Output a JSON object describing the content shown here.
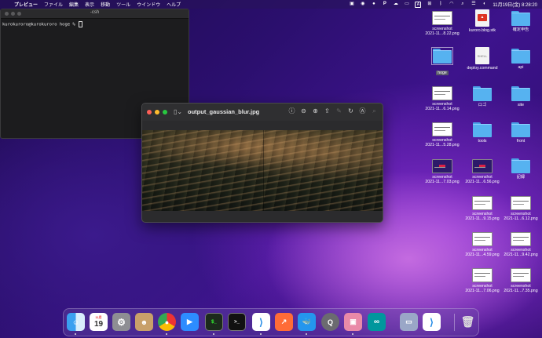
{
  "menubar": {
    "app_name": "プレビュー",
    "menus": [
      "ファイル",
      "編集",
      "表示",
      "移動",
      "ツール",
      "ウインドウ",
      "ヘルプ"
    ],
    "status_icons": [
      "display-icon",
      "accessibility-icon",
      "record-icon",
      "parking-icon",
      "cloud-icon",
      "cast-icon",
      "text-input-icon",
      "grid-icon",
      "bluetooth-icon",
      "wifi-icon",
      "search-icon",
      "control-center-icon",
      "siri-icon"
    ],
    "input_label": "A",
    "clock": "11月19日(金) 8:28:20"
  },
  "terminal": {
    "title": "-csh",
    "prompt": "kurokuroro@kurokuroro hoge % "
  },
  "preview": {
    "title": "output_gaussian_blur.jpg",
    "traffic_colors": [
      "#ff5f57",
      "#febc2e",
      "#28c840"
    ]
  },
  "desktop": {
    "icons": [
      {
        "kind": "shot",
        "label1": "screenshot",
        "label2": "2021-11...8.22.png"
      },
      {
        "kind": "doc",
        "label1": "kuroro.blog.stk",
        "label2": ""
      },
      {
        "kind": "folder",
        "label1": "確定申告",
        "label2": ""
      },
      {
        "kind": "folder",
        "label1": "hoge",
        "label2": "",
        "selected": true
      },
      {
        "kind": "shell",
        "label1": "deploy.command",
        "label2": ""
      },
      {
        "kind": "folder",
        "label1": "api",
        "label2": ""
      },
      {
        "kind": "shot",
        "label1": "screenshot",
        "label2": "2021-11...6.14.png"
      },
      {
        "kind": "folder",
        "label1": "ロゴ",
        "label2": ""
      },
      {
        "kind": "folder",
        "label1": "site",
        "label2": ""
      },
      {
        "kind": "shot",
        "label1": "screenshot",
        "label2": "2021-11...5.28.png"
      },
      {
        "kind": "folder",
        "label1": "tools",
        "label2": ""
      },
      {
        "kind": "folder",
        "label1": "front",
        "label2": ""
      },
      {
        "kind": "shotdark",
        "label1": "screenshot",
        "label2": "2021-11...7.03.png"
      },
      {
        "kind": "shotdark",
        "label1": "screenshot",
        "label2": "2021-11...6.56.png"
      },
      {
        "kind": "folder",
        "label1": "記録",
        "label2": ""
      },
      {
        "kind": "shot",
        "label1": "screenshot",
        "label2": "2021-11...9.15.png"
      },
      {
        "kind": "shot",
        "label1": "screenshot",
        "label2": "2021-11...6.12.png"
      },
      {
        "kind": "shot",
        "label1": "screenshot",
        "label2": "2021-11...4.59.png"
      },
      {
        "kind": "shot",
        "label1": "screenshot",
        "label2": "2021-11...9.42.png"
      },
      {
        "kind": "shot",
        "label1": "screenshot",
        "label2": "2021-11...7.06.png"
      },
      {
        "kind": "shot",
        "label1": "screenshot",
        "label2": "2021-11...7.35.png"
      }
    ]
  },
  "dock": {
    "calendar_month": "11月",
    "calendar_day": "19",
    "apps": [
      "finder",
      "calendar",
      "system-preferences",
      "contacts",
      "chrome",
      "zoom",
      "terminal",
      "terminal-dark",
      "vscode",
      "postman",
      "docker",
      "quicktime",
      "preview",
      "arduino",
      "screenshot-app",
      "vscode-2",
      "trash"
    ],
    "terminal_glyph": "$_",
    "terminal_dark_glyph": ">_"
  }
}
